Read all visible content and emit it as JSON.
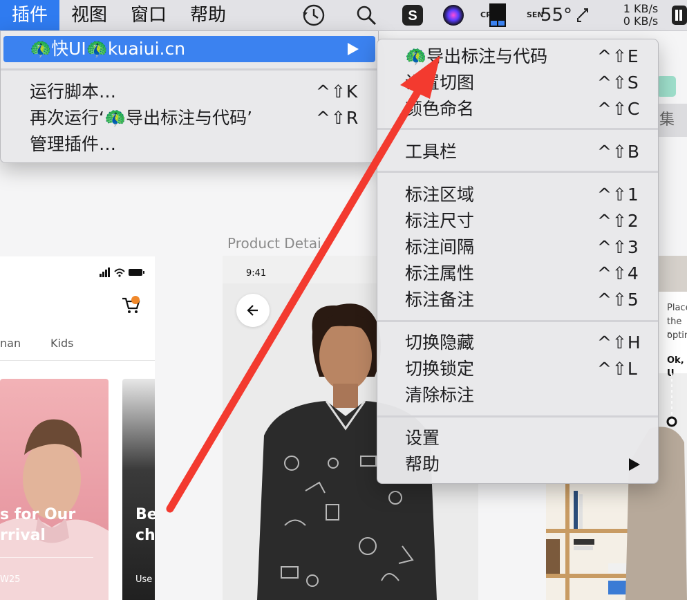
{
  "menubar": {
    "items": [
      "插件",
      "视图",
      "窗口",
      "帮助"
    ],
    "active_index": 0,
    "tray": {
      "temperature": "55°",
      "cpu_label": "CPU",
      "sensor_label": "SEN",
      "net_up": "1 KB/s",
      "net_down": "0 KB/s"
    }
  },
  "plugins_menu": {
    "highlighted": {
      "label": "🦚快UI🦚kuaiui.cn"
    },
    "items": [
      {
        "label": "运行脚本…",
        "shortcut": "^⇧K"
      },
      {
        "label": "再次运行‘🦚导出标注与代码’",
        "shortcut": "^⇧R"
      },
      {
        "label": "管理插件…",
        "shortcut": ""
      }
    ]
  },
  "submenu": {
    "groups": [
      [
        {
          "label": "🦚导出标注与代码",
          "shortcut": "^⇧E"
        },
        {
          "label": "设置切图",
          "shortcut": "^⇧S"
        },
        {
          "label": "颜色命名",
          "shortcut": "^⇧C"
        }
      ],
      [
        {
          "label": "工具栏",
          "shortcut": "^⇧B"
        }
      ],
      [
        {
          "label": "标注区域",
          "shortcut": "^⇧1"
        },
        {
          "label": "标注尺寸",
          "shortcut": "^⇧2"
        },
        {
          "label": "标注间隔",
          "shortcut": "^⇧3"
        },
        {
          "label": "标注属性",
          "shortcut": "^⇧4"
        },
        {
          "label": "标注备注",
          "shortcut": "^⇧5"
        }
      ],
      [
        {
          "label": "切换隐藏",
          "shortcut": "^⇧H"
        },
        {
          "label": "切换锁定",
          "shortcut": "^⇧L"
        },
        {
          "label": "清除标注",
          "shortcut": ""
        }
      ],
      [
        {
          "label": "设置",
          "shortcut": ""
        },
        {
          "label": "帮助",
          "shortcut": "",
          "has_submenu": true
        }
      ]
    ]
  },
  "canvas": {
    "artboard_title": "Product Detai",
    "left_artboard": {
      "tabs": [
        "nan",
        "Kids"
      ],
      "card1_title_line1": "s for Our",
      "card1_title_line2": "rrival",
      "card1_small": "W25",
      "card2_title_line1": "Be",
      "card2_title_line2": "ch",
      "card2_small": "Use"
    },
    "mid_artboard": {
      "status_time": "9:41"
    },
    "right_artboard": {
      "text_line1": "Place",
      "text_line2": "the r",
      "text_line3": "optin",
      "button_text": "Ok, U",
      "top_right_text": "集"
    }
  },
  "colors": {
    "menu_highlight": "#3b82f0",
    "menubar_active": "#2f7bf0",
    "annotation_arrow": "#f33a2f",
    "cart_badge": "#f0882a"
  }
}
